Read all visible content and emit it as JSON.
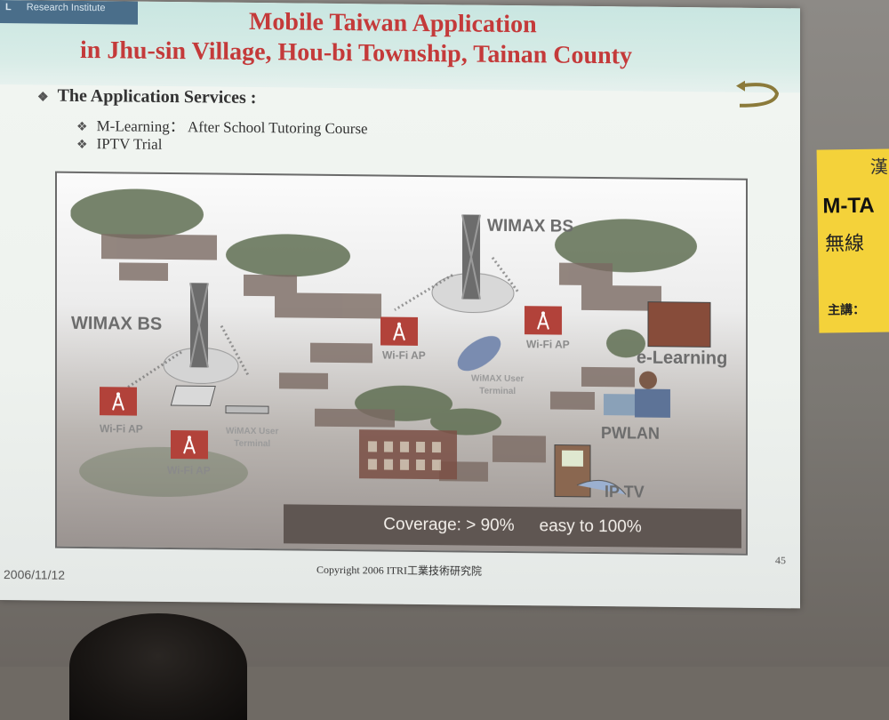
{
  "header": {
    "logo_text": "Research Institute",
    "logo_mark": "L",
    "title_line1": "Mobile Taiwan Application",
    "title_line2": "in Jhu-sin Village, Hou-bi Township, Tainan County"
  },
  "bullets": {
    "heading": "The Application Services :",
    "items": [
      "M-Learning： After School Tutoring Course",
      "IPTV Trial"
    ],
    "glyph": "❖"
  },
  "diagram": {
    "labels": {
      "wimax_bs_left": "WIMAX BS",
      "wimax_bs_top": "WIMAX BS",
      "wifi_ap_1": "Wi-Fi AP",
      "wifi_ap_2": "Wi-Fi AP",
      "wifi_ap_3": "Wi-Fi AP",
      "wifi_ap_4": "Wi-Fi AP",
      "wimax_terminal_left_l1": "WiMAX User",
      "wimax_terminal_left_l2": "Terminal",
      "wimax_terminal_mid_l1": "WiMAX User",
      "wimax_terminal_mid_l2": "Terminal",
      "e_learning": "e-Learning",
      "pwlan": "PWLAN",
      "iptv": "IP TV"
    },
    "coverage": {
      "part1": "Coverage: > 90%",
      "part2": "easy to 100%"
    }
  },
  "footer": {
    "date": "2006/11/12",
    "copyright": "Copyright 2006 ITRI工業技術研究院",
    "page": "45"
  },
  "sticky_note": {
    "line1": "漢",
    "line2": "M-TA",
    "line3": "無線",
    "line4": "主講："
  },
  "colors": {
    "title": "#c43a3a",
    "wifi_badge": "#b2423a",
    "sticky": "#f4d23a"
  }
}
